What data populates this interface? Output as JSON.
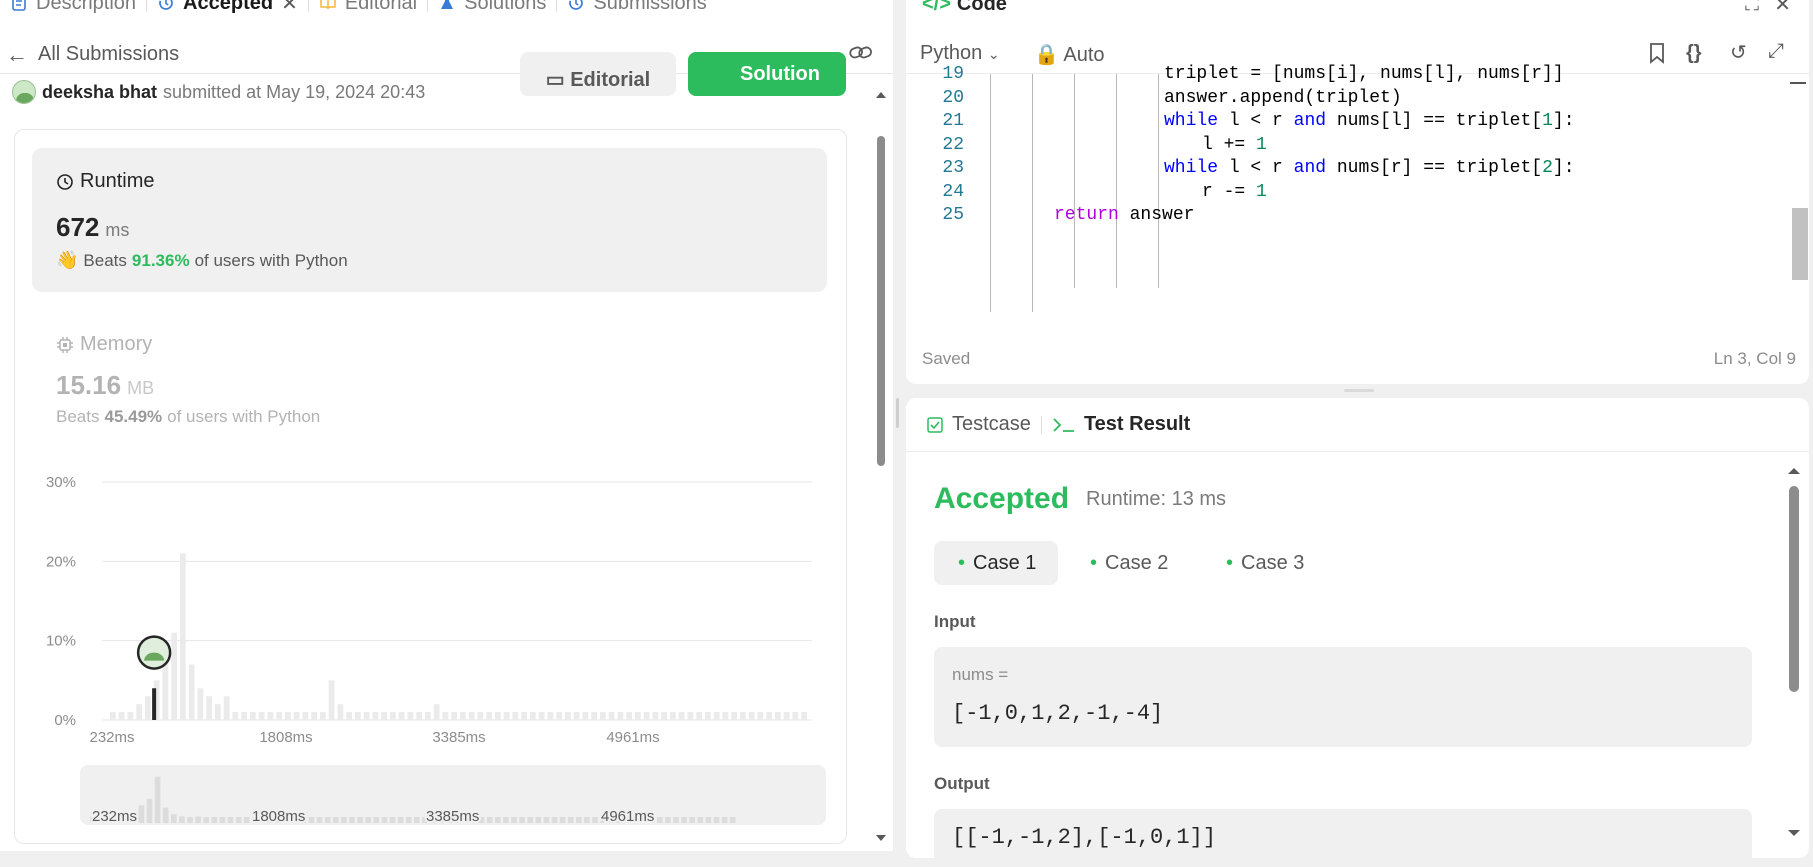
{
  "tabs": [
    {
      "label": "Description",
      "icon": "description-icon"
    },
    {
      "label": "Accepted",
      "icon": "history-icon",
      "active": true
    },
    {
      "label": "Editorial",
      "icon": "book-icon"
    },
    {
      "label": "Solutions",
      "icon": "flask-icon"
    },
    {
      "label": "Submissions",
      "icon": "history-icon"
    }
  ],
  "subheader": {
    "back_label": "All Submissions"
  },
  "submission": {
    "author": "deeksha bhat",
    "submitted_text": "submitted at May 19, 2024 20:43"
  },
  "buttons": {
    "editorial": "Editorial",
    "solution": "Solution"
  },
  "runtime": {
    "label": "Runtime",
    "value": "672",
    "unit": "ms",
    "beats_word": "Beats",
    "beats_pct": "91.36%",
    "beats_tail": "of users with Python"
  },
  "memory": {
    "label": "Memory",
    "value": "15.16",
    "unit": "MB",
    "beats_word": "Beats",
    "beats_pct": "45.49%",
    "beats_tail": "of users with Python"
  },
  "chart_data": {
    "type": "bar",
    "ylabels": [
      "30%",
      "20%",
      "10%",
      "0%"
    ],
    "ylim": [
      0,
      30
    ],
    "xlabels": [
      "232ms",
      "1808ms",
      "3385ms",
      "4961ms"
    ],
    "values": [
      1,
      1,
      1,
      2,
      3,
      5,
      8,
      11,
      21,
      7,
      4,
      3,
      2,
      3,
      1,
      1,
      1,
      1,
      1,
      1,
      1,
      1,
      1,
      1,
      1,
      5,
      2,
      1,
      1,
      1,
      1,
      1,
      1,
      1,
      1,
      1,
      1,
      2,
      1,
      1,
      1,
      1,
      1,
      1,
      1,
      1,
      1,
      1,
      1,
      1,
      1,
      1,
      1,
      1,
      1,
      1,
      1,
      1,
      1,
      1,
      1,
      1,
      1,
      1,
      1,
      1,
      1,
      1,
      1,
      1,
      1,
      1,
      1,
      1,
      1,
      1,
      1,
      1,
      1,
      1
    ],
    "marker_index": 5,
    "mini_xlabels": [
      "232ms",
      "1808ms",
      "3385ms",
      "4961ms"
    ]
  },
  "code": {
    "title": "Code",
    "language": "Python",
    "mode": "Auto",
    "lines": [
      {
        "n": "19",
        "text": "triplet = [nums[i], nums[l], nums[r]]",
        "indent": 4
      },
      {
        "n": "20",
        "text": "answer.append(triplet)",
        "indent": 4
      },
      {
        "n": "21",
        "text": "while l < r and nums[l] == triplet[1]:",
        "indent": 4
      },
      {
        "n": "22",
        "text": "l += 1",
        "indent": 5
      },
      {
        "n": "23",
        "text": "while l < r and nums[r] == triplet[2]:",
        "indent": 4
      },
      {
        "n": "24",
        "text": "r -= 1",
        "indent": 5
      },
      {
        "n": "25",
        "text": "return answer",
        "indent": 1
      }
    ],
    "status": "Saved",
    "cursor": "Ln 3, Col 9"
  },
  "result": {
    "tab_testcase": "Testcase",
    "tab_result": "Test Result",
    "status": "Accepted",
    "runtime": "Runtime: 13 ms",
    "cases": [
      "Case 1",
      "Case 2",
      "Case 3"
    ],
    "input_label": "Input",
    "input_var": "nums =",
    "input_value": "[-1,0,1,2,-1,-4]",
    "output_label": "Output",
    "output_value": "[[-1,-1,2],[-1,0,1]]"
  },
  "colors": {
    "accent": "#2cbb5d",
    "blue": "#3a7bd5"
  }
}
